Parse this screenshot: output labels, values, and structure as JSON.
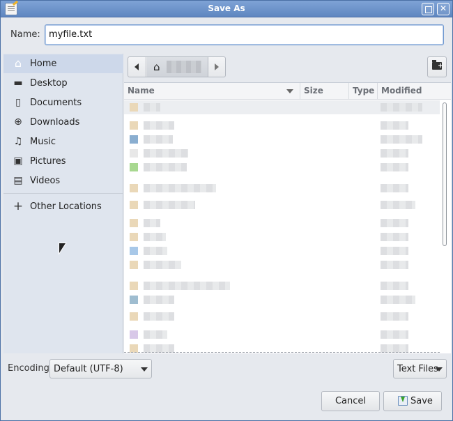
{
  "window": {
    "title": "Save As"
  },
  "name_row": {
    "label": "Name:",
    "value": "myfile.txt"
  },
  "sidebar": {
    "items": [
      {
        "label": "Home",
        "icon": "home-icon",
        "glyph": "⌂"
      },
      {
        "label": "Desktop",
        "icon": "folder-icon",
        "glyph": "▬"
      },
      {
        "label": "Documents",
        "icon": "document-icon",
        "glyph": "▯"
      },
      {
        "label": "Downloads",
        "icon": "download-icon",
        "glyph": "⊕"
      },
      {
        "label": "Music",
        "icon": "music-icon",
        "glyph": "♫"
      },
      {
        "label": "Pictures",
        "icon": "pictures-icon",
        "glyph": "▣"
      },
      {
        "label": "Videos",
        "icon": "video-icon",
        "glyph": "▤"
      }
    ],
    "other": {
      "label": "Other Locations",
      "icon": "plus-icon",
      "glyph": "+"
    }
  },
  "columns": {
    "name": "Name",
    "size": "Size",
    "type": "Type",
    "modified": "Modified"
  },
  "encoding": {
    "label": "Encoding:",
    "value": "Default (UTF-8)"
  },
  "filter": {
    "value": "Text Files"
  },
  "buttons": {
    "cancel": "Cancel",
    "save": "Save"
  },
  "colors": {
    "titlebar": "#6d93cb",
    "selection": "#cdd8ea",
    "accent": "#6e98cf"
  }
}
